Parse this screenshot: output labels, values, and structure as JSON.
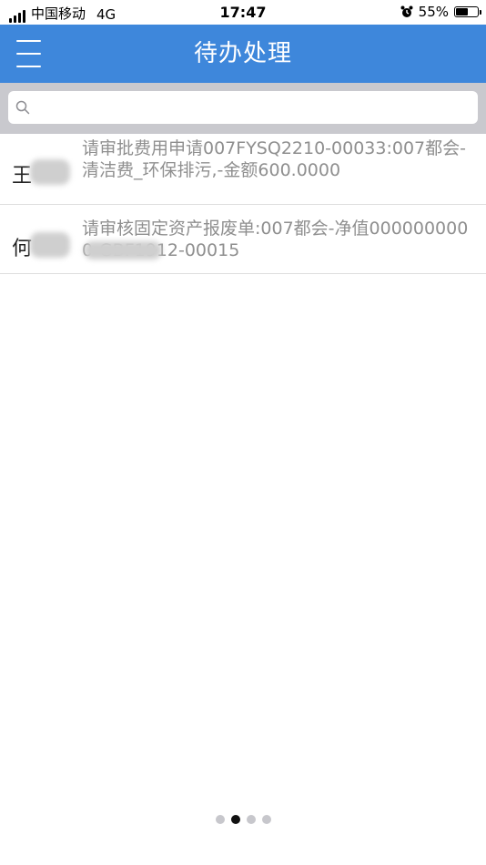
{
  "status_bar": {
    "carrier": "中国移动",
    "network": "4G",
    "time": "17:47",
    "battery_percent": "55%",
    "battery_level": 0.55,
    "alarm_icon": "alarm-clock-icon"
  },
  "header": {
    "title": "待办处理",
    "menu_icon": "hamburger-menu-icon",
    "background_color": "#3e87db"
  },
  "search": {
    "placeholder": "",
    "value": "",
    "icon": "search-icon"
  },
  "todo_list": [
    {
      "sender_visible": "王",
      "content": "请审批费用申请007FYSQ2210-00033:007都会-清洁费_环保排污,-金额600.0000"
    },
    {
      "sender_visible": "何",
      "content": "请审核固定资产报废单:007都会-净值0000000000-GBF1912-00015"
    }
  ],
  "pager": {
    "page_count": 4,
    "active_index": 1
  }
}
